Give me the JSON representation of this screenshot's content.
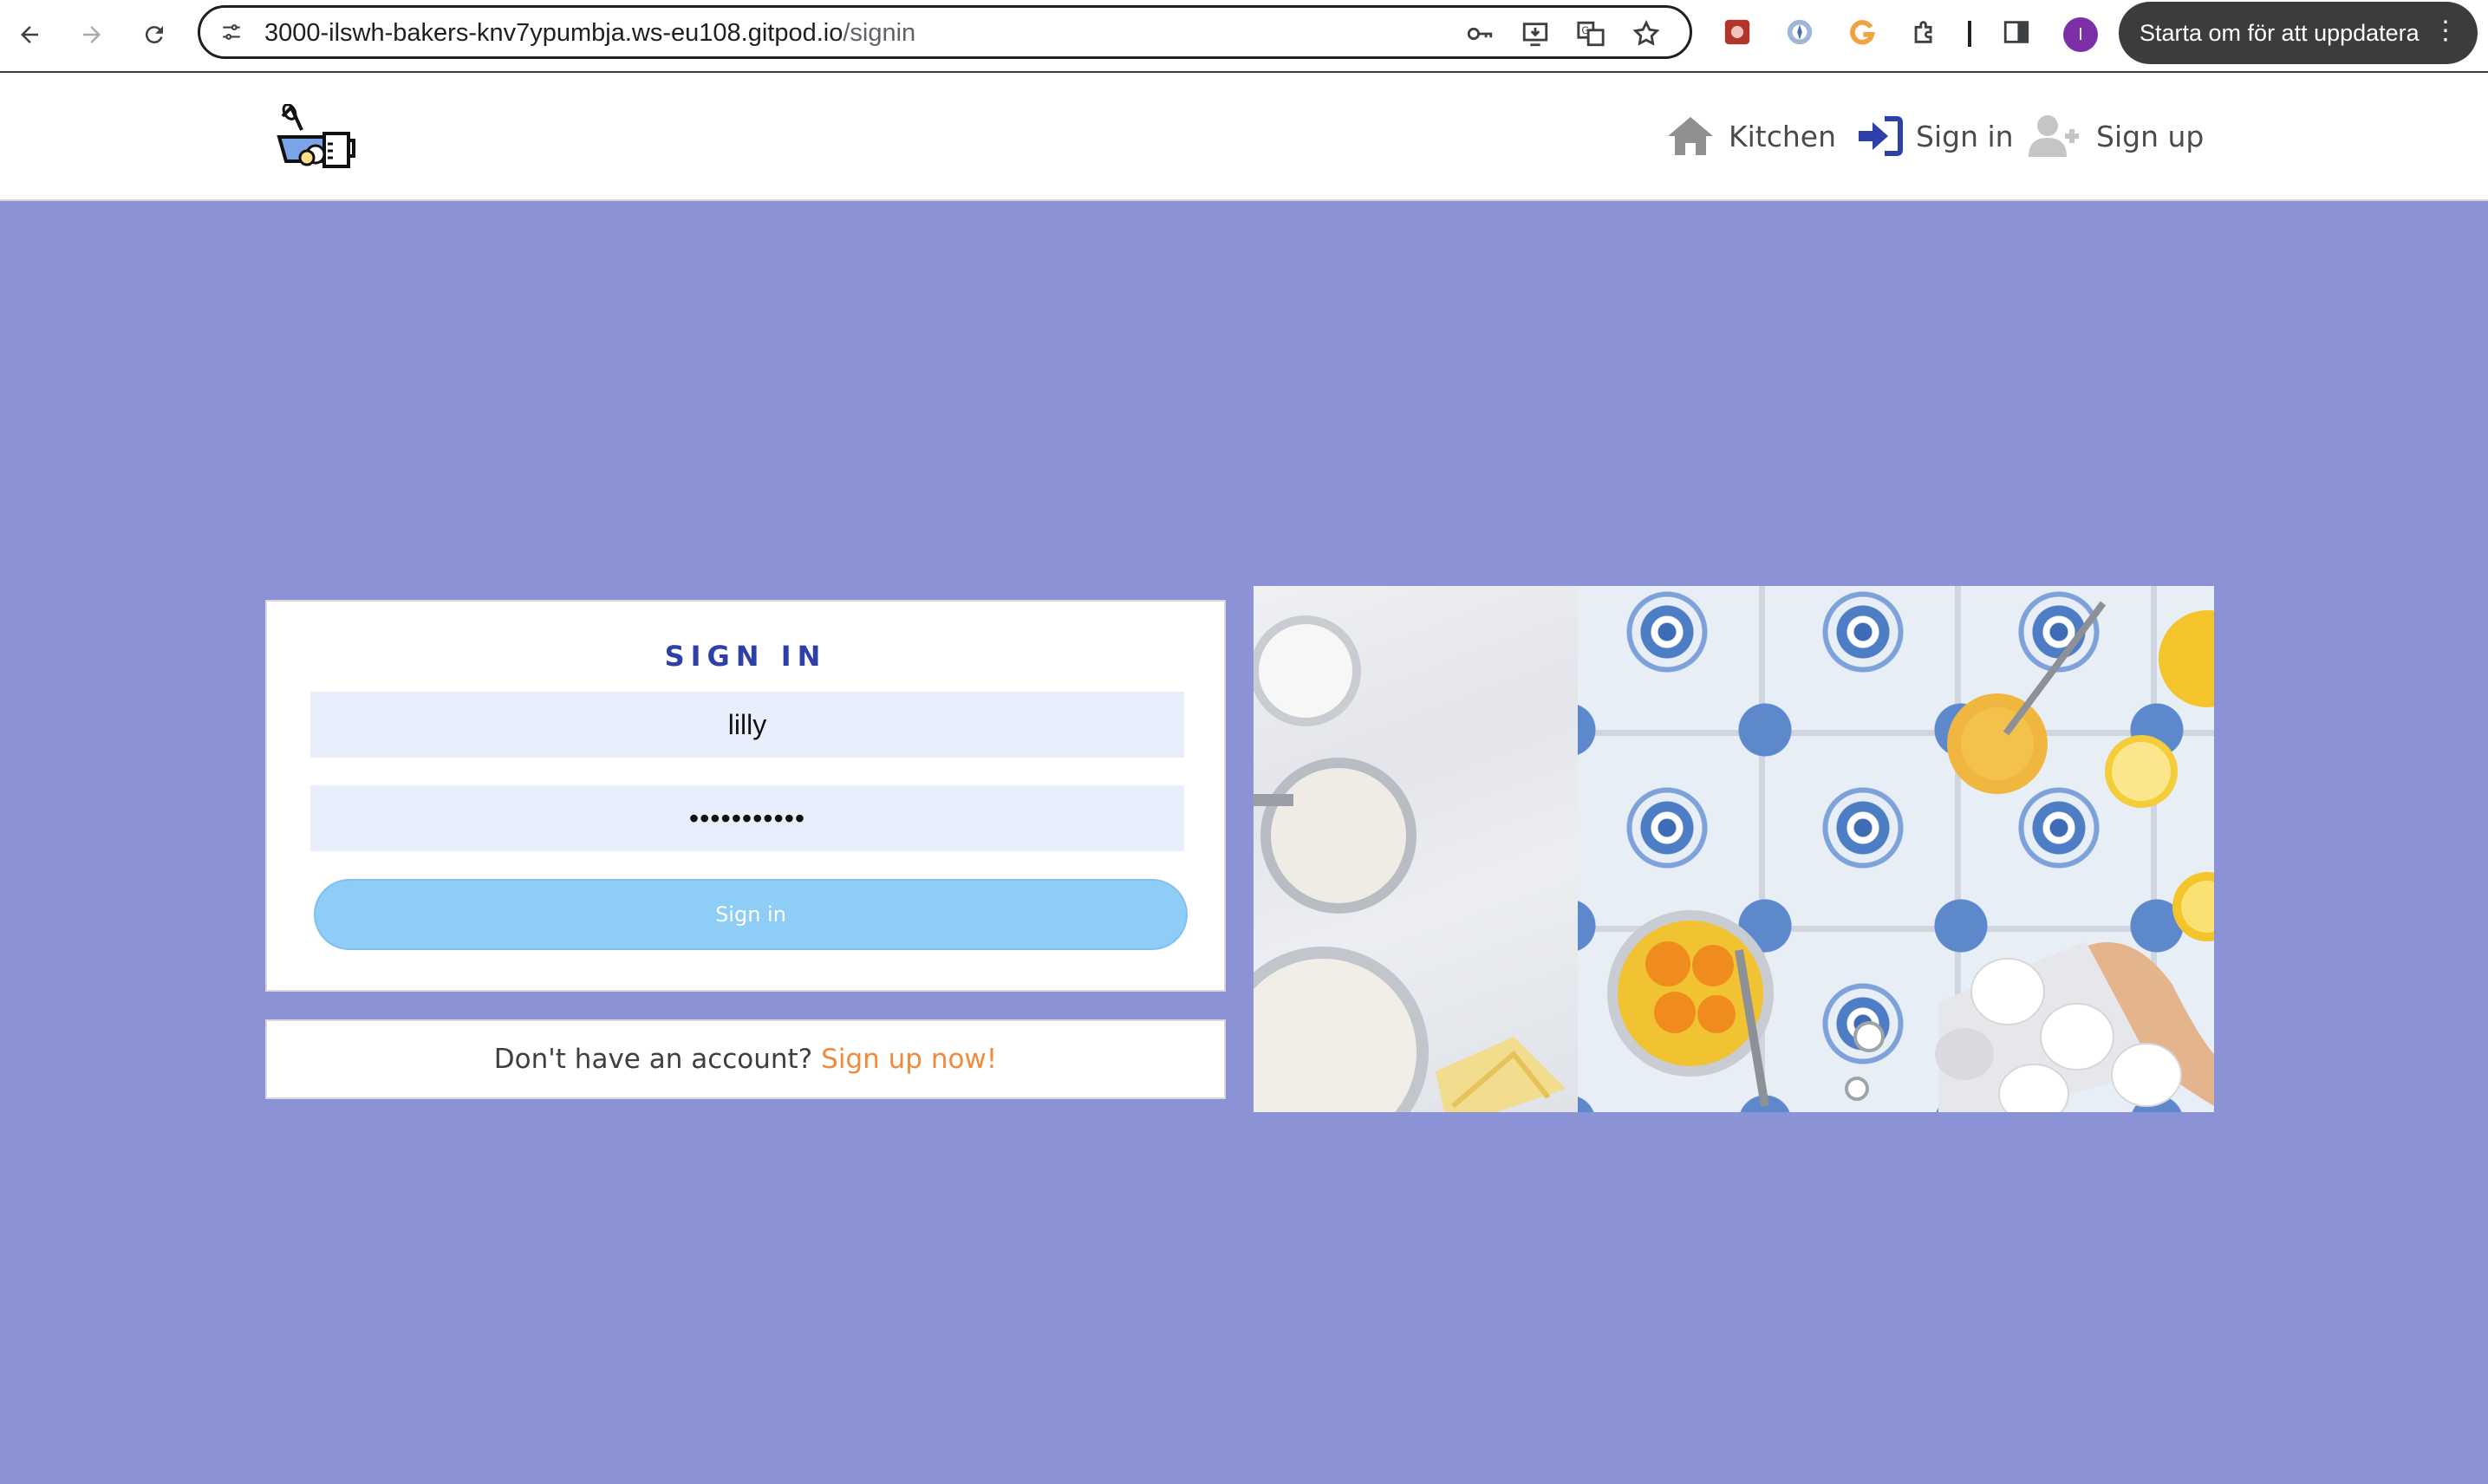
{
  "browser": {
    "url_host": "3000-ilswh-bakers-knv7ypumbja.ws-eu108.gitpod.io",
    "url_path": "/signin",
    "profile_initial": "I",
    "update_button_label": "Starta om för att uppdatera",
    "menu_glyph": "⋮"
  },
  "header": {
    "nav": [
      {
        "label": "Kitchen",
        "icon": "home-icon"
      },
      {
        "label": "Sign in",
        "icon": "sign-in-icon"
      },
      {
        "label": "Sign up",
        "icon": "user-plus-icon"
      }
    ]
  },
  "signin": {
    "title": "SIGN IN",
    "username_value": "lilly",
    "password_value": "•••••••••••",
    "submit_label": "Sign in"
  },
  "signup_prompt": {
    "text": "Don't have an account?",
    "link": "Sign up now!"
  },
  "colors": {
    "page_background": "#8b93d6",
    "title_blue": "#2d40a8",
    "link_orange": "#f08a3c",
    "button_blue": "#8ecdf6"
  }
}
